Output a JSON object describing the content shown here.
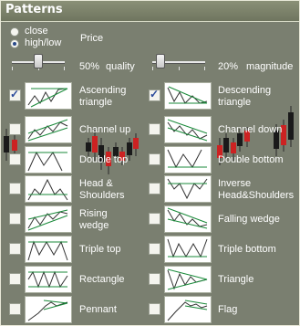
{
  "panel": {
    "title": "Patterns"
  },
  "price": {
    "label": "Price",
    "options": [
      {
        "label": "close",
        "selected": false
      },
      {
        "label": "high/low",
        "selected": true
      }
    ]
  },
  "sliders": {
    "quality": {
      "value_text": "50%",
      "label": "quality",
      "value": 0.5
    },
    "magnitude": {
      "value_text": "20%",
      "label": "magnitude",
      "value": 0.2
    }
  },
  "patterns": [
    {
      "label1": "Ascending",
      "label2": "triangle",
      "checked": true,
      "icon": "ascending-triangle-icon"
    },
    {
      "label1": "Descending",
      "label2": "triangle",
      "checked": true,
      "icon": "descending-triangle-icon"
    },
    {
      "label1": "Channel up",
      "label2": "",
      "checked": false,
      "icon": "channel-up-icon"
    },
    {
      "label1": "Channel down",
      "label2": "",
      "checked": false,
      "icon": "channel-down-icon"
    },
    {
      "label1": "Double top",
      "label2": "",
      "checked": false,
      "icon": "double-top-icon"
    },
    {
      "label1": "Double bottom",
      "label2": "",
      "checked": false,
      "icon": "double-bottom-icon"
    },
    {
      "label1": "Head &",
      "label2": "Shoulders",
      "checked": false,
      "icon": "head-shoulders-icon"
    },
    {
      "label1": "Inverse",
      "label2": "Head&Shoulders",
      "checked": false,
      "icon": "inverse-head-shoulders-icon"
    },
    {
      "label1": "Rising",
      "label2": "wedge",
      "checked": false,
      "icon": "rising-wedge-icon"
    },
    {
      "label1": "Falling wedge",
      "label2": "",
      "checked": false,
      "icon": "falling-wedge-icon"
    },
    {
      "label1": "Triple top",
      "label2": "",
      "checked": false,
      "icon": "triple-top-icon"
    },
    {
      "label1": "Triple bottom",
      "label2": "",
      "checked": false,
      "icon": "triple-bottom-icon"
    },
    {
      "label1": "Rectangle",
      "label2": "",
      "checked": false,
      "icon": "rectangle-icon"
    },
    {
      "label1": "Triangle",
      "label2": "",
      "checked": false,
      "icon": "triangle-icon"
    },
    {
      "label1": "Pennant",
      "label2": "",
      "checked": false,
      "icon": "pennant-icon"
    },
    {
      "label1": "Flag",
      "label2": "",
      "checked": false,
      "icon": "flag-icon"
    }
  ]
}
